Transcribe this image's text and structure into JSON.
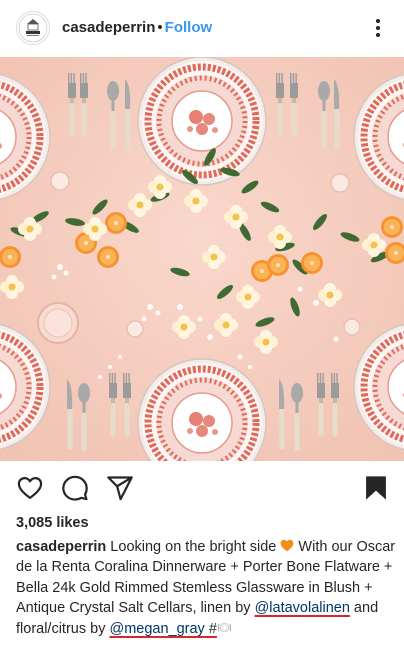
{
  "header": {
    "username": "casadeperrin",
    "separator": "•",
    "follow_label": "Follow",
    "avatar_logo_text": "PERRIN"
  },
  "post": {
    "likes_text": "3,085 likes",
    "caption": {
      "username": "casadeperrin",
      "text_part1": " Looking on the bright side ",
      "text_part2": " With our Oscar de la Renta Coralina Dinnerware + Porter Bone Flatware + Bella 24k Gold Rimmed Stemless Glassware in Blush + Antique Crystal Salt Cellars, linen by ",
      "mention1": "@latavolalinen",
      "text_part3": " and floral/citrus by ",
      "mention2": "@megan_gray",
      "text_part4": " #"
    }
  },
  "icons": {
    "like": "heart-outline-icon",
    "comment": "comment-bubble-icon",
    "share": "paper-plane-icon",
    "save": "bookmark-filled-icon",
    "more": "more-vertical-icon"
  },
  "colors": {
    "follow": "#3897f0",
    "mention": "#003569",
    "underline": "#d9262a",
    "tablecloth": "#f6cfc2",
    "coral": "#e06a5a",
    "orange_fruit": "#f7932f",
    "foliage": "#3f6b32"
  }
}
